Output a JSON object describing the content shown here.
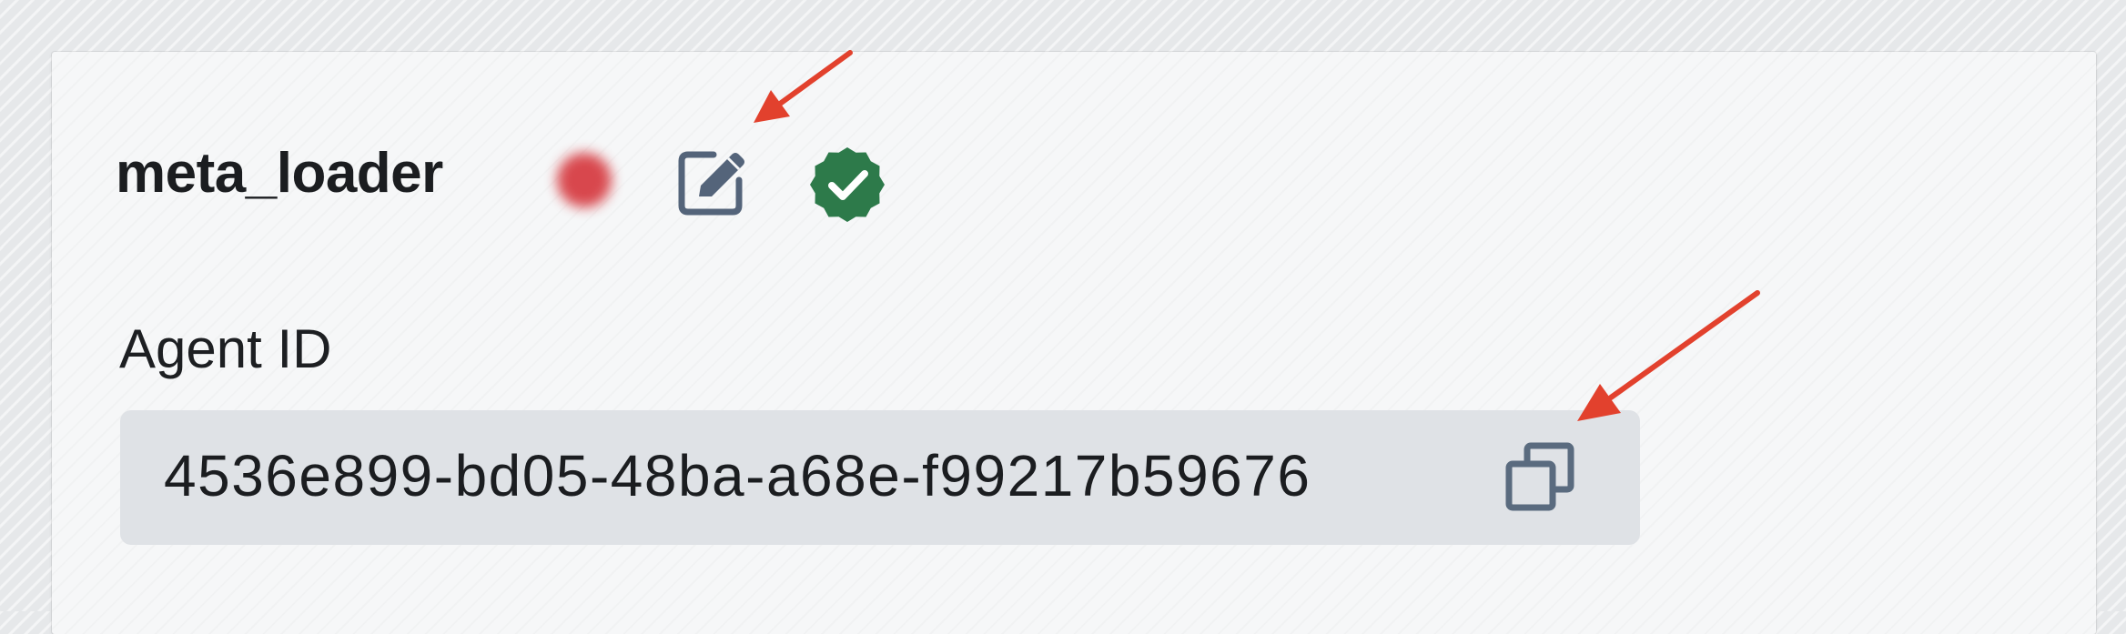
{
  "agent": {
    "name": "meta_loader",
    "status_color": "#d6393f",
    "edit_icon": "edit-icon",
    "verified_icon": "verified-badge-icon",
    "verified_color": "#2d7a4a"
  },
  "agent_id": {
    "label": "Agent ID",
    "value": "4536e899-bd05-48ba-a68e-f99217b59676",
    "copy_icon": "copy-icon"
  },
  "annotations": {
    "arrow_color": "#e2412d"
  }
}
